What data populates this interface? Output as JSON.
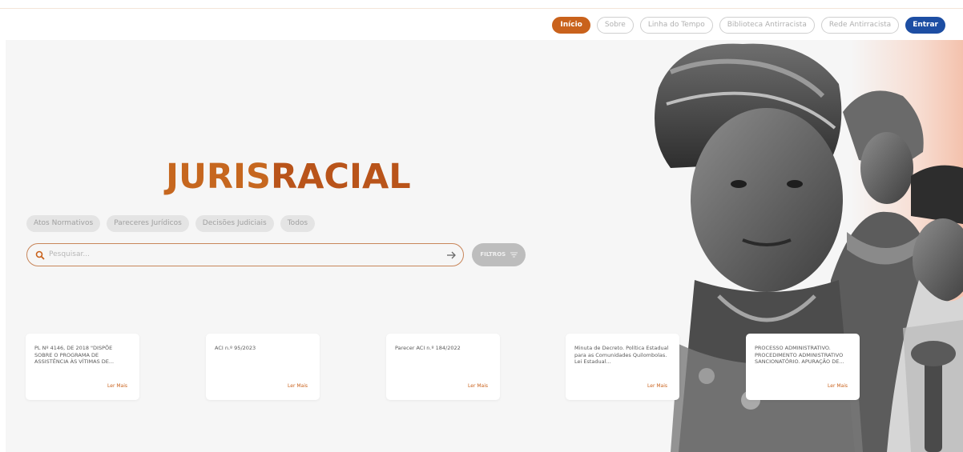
{
  "nav": {
    "items": [
      {
        "label": "Início",
        "state": "active"
      },
      {
        "label": "Sobre",
        "state": "default"
      },
      {
        "label": "Linha do Tempo",
        "state": "default"
      },
      {
        "label": "Biblioteca Antirracista",
        "state": "default"
      },
      {
        "label": "Rede Antirracista",
        "state": "default"
      },
      {
        "label": "Entrar",
        "state": "primary"
      }
    ]
  },
  "hero": {
    "logo_part1": "JURIS",
    "logo_part2": "RACIAL"
  },
  "categories": [
    "Atos Normativos",
    "Pareceres Jurídicos",
    "Decisões Judiciais",
    "Todos"
  ],
  "search": {
    "placeholder": "Pesquisar...",
    "icon": "search-icon",
    "submit_icon": "arrow-right-icon"
  },
  "filters": {
    "label": "FILTROS",
    "icon": "filter-lines-icon"
  },
  "cards": [
    {
      "text": "PL Nº 4146, DE 2018 \"DISPÕE SOBRE O PROGRAMA DE ASSISTÊNCIA ÀS VÍTIMAS DE...",
      "link": "Ler Mais"
    },
    {
      "text": "ACI n.º 95/2023",
      "link": "Ler Mais"
    },
    {
      "text": "Parecer ACI n.º 184/2022",
      "link": "Ler Mais"
    },
    {
      "text": "Minuta de Decreto. Política Estadual para as Comunidades Quilombolas. Lei Estadual...",
      "link": "Ler Mais"
    },
    {
      "text": "PROCESSO ADMINISTRATIVO. PROCEDIMENTO ADMINISTRATIVO SANCIONATÓRIO. APURAÇÃO DE...",
      "link": "Ler Mais"
    }
  ],
  "colors": {
    "accent": "#c9621c",
    "primary": "#1d4ea3",
    "hero_bg": "#f6f6f6"
  }
}
